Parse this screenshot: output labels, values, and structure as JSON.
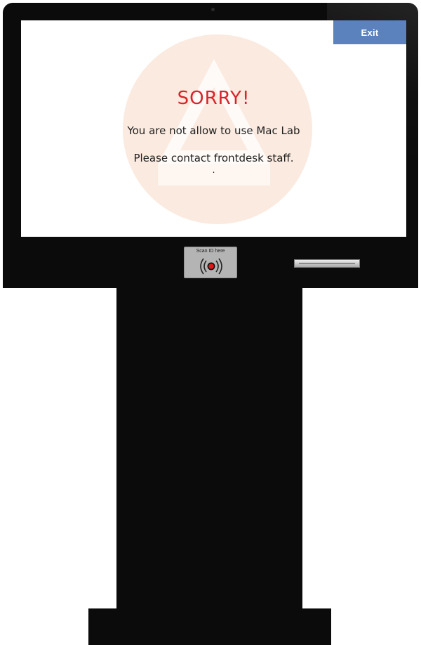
{
  "screen": {
    "exit_label": "Exit",
    "title": "SORRY!",
    "message_line1": "You are not allow to use Mac Lab",
    "message_line2": "Please contact frontdesk staff.",
    "message_dot": ".",
    "colors": {
      "title": "#d8242a",
      "exit_button": "#5b82bd",
      "watermark": "#fbeadf"
    }
  },
  "hardware": {
    "card_reader_label": "Scan ID here",
    "card_reader_icon": "nfc-scan-icon",
    "receipt_slot": "receipt-slot"
  }
}
